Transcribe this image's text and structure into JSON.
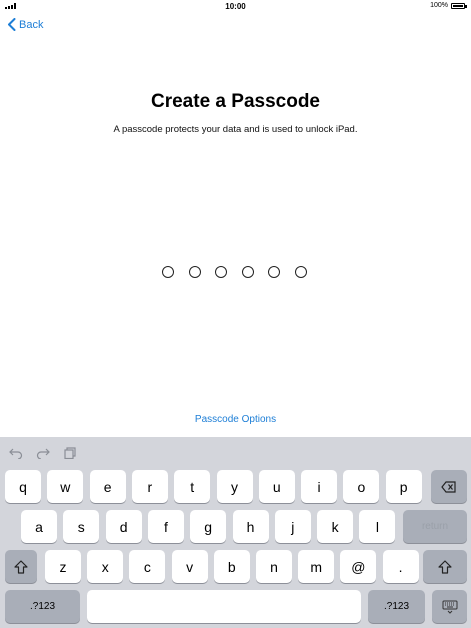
{
  "status": {
    "time": "10:00",
    "battery": "100%"
  },
  "nav": {
    "back_label": "Back"
  },
  "main": {
    "title": "Create a Passcode",
    "subtitle": "A passcode protects your data and is used to unlock iPad.",
    "passcode_length": 6,
    "options_label": "Passcode Options"
  },
  "keyboard": {
    "toolbar_icons": [
      "undo-icon",
      "redo-icon",
      "paste-icon"
    ],
    "row1": [
      "q",
      "w",
      "e",
      "r",
      "t",
      "y",
      "u",
      "i",
      "o",
      "p"
    ],
    "row2": [
      "a",
      "s",
      "d",
      "f",
      "g",
      "h",
      "j",
      "k",
      "l"
    ],
    "row3": [
      "z",
      "x",
      "c",
      "v",
      "b",
      "n",
      "m",
      "@",
      "."
    ],
    "return_label": "return",
    "numbers_label": ".?123",
    "accent": "#1d7ed6"
  }
}
